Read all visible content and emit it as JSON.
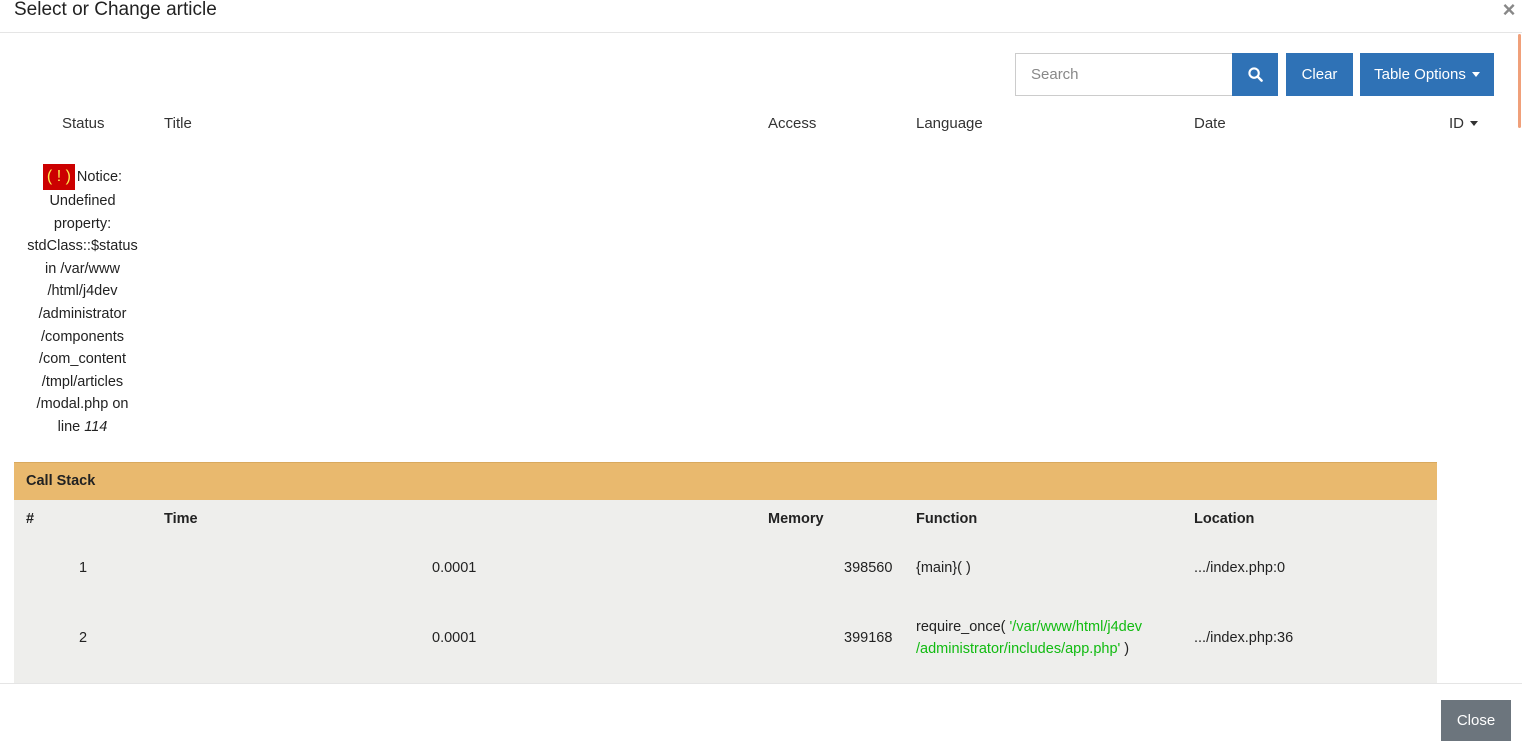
{
  "modal": {
    "title": "Select or Change article",
    "close_x": "×"
  },
  "toolbar": {
    "search_placeholder": "Search",
    "clear_label": "Clear",
    "table_options_label": "Table Options"
  },
  "table": {
    "headers": {
      "status": "Status",
      "title": "Title",
      "access": "Access",
      "language": "Language",
      "date": "Date",
      "id": "ID"
    }
  },
  "notice": {
    "icon_text": "( ! )",
    "label": "Notice:",
    "lines": [
      "Undefined",
      "property:",
      "stdClass::$status",
      "in /var/www",
      "/html/j4dev",
      "/administrator",
      "/components",
      "/com_content",
      "/tmpl/articles",
      "/modal.php on",
      "line"
    ],
    "line_number": "114"
  },
  "call_stack": {
    "title": "Call Stack",
    "headers": {
      "num": "#",
      "time": "Time",
      "memory": "Memory",
      "function": "Function",
      "location": "Location"
    },
    "rows": [
      {
        "num": "1",
        "time": "0.0001",
        "memory": "398560",
        "function": "{main}( )",
        "location": ".../index.php:0"
      },
      {
        "num": "2",
        "time": "0.0001",
        "memory": "399168",
        "function_name": "require_once(",
        "function_arg_line1": "'/var/www/html/j4dev",
        "function_arg_line2": "/administrator/includes/app.php'",
        "function_close": " )",
        "location": ".../index.php:36"
      }
    ]
  },
  "footer": {
    "close_label": "Close"
  },
  "colors": {
    "primary": "#2f72b6",
    "callstack_header": "#e9b96e",
    "callstack_body": "#eeeeec",
    "notice_icon_bg": "#cc0000",
    "notice_icon_fg": "#fce94f",
    "string_green": "#11bb11",
    "secondary_button": "#6c757d"
  }
}
